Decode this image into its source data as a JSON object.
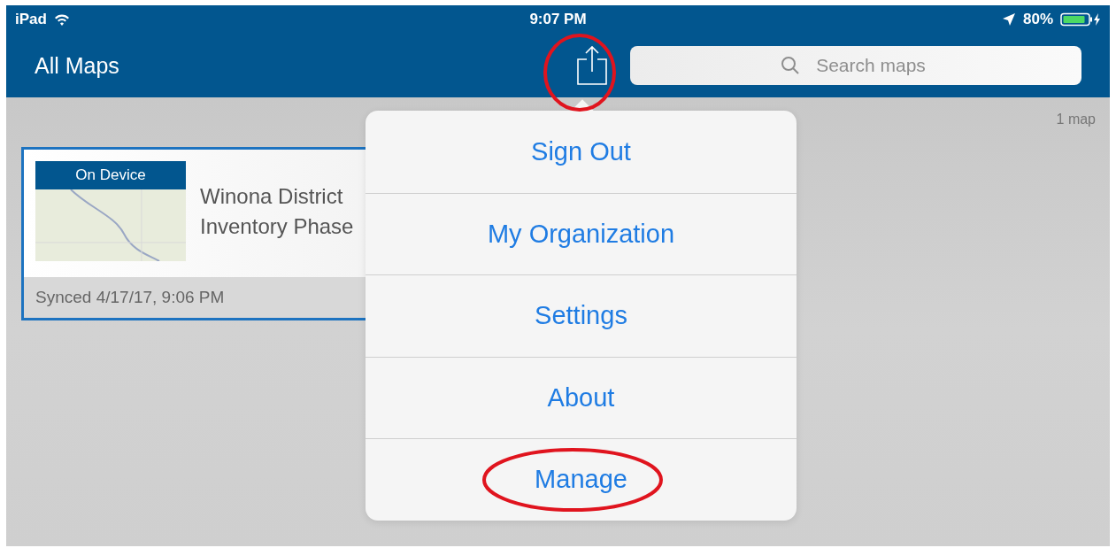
{
  "status_bar": {
    "device": "iPad",
    "time": "9:07 PM",
    "battery": "80%"
  },
  "nav_bar": {
    "title": "All Maps",
    "search": {
      "placeholder": "Search maps"
    }
  },
  "map_count": "1 map",
  "maps": [
    {
      "badge": "On Device",
      "title_lines": [
        "Winona District",
        "Inventory Phase"
      ],
      "synced": "Synced 4/17/17, 9:06 PM"
    }
  ],
  "menu": {
    "items": [
      {
        "label": "Sign Out",
        "highlighted": false
      },
      {
        "label": "My Organization",
        "highlighted": false
      },
      {
        "label": "Settings",
        "highlighted": false
      },
      {
        "label": "About",
        "highlighted": false
      },
      {
        "label": "Manage",
        "highlighted": true
      }
    ]
  }
}
